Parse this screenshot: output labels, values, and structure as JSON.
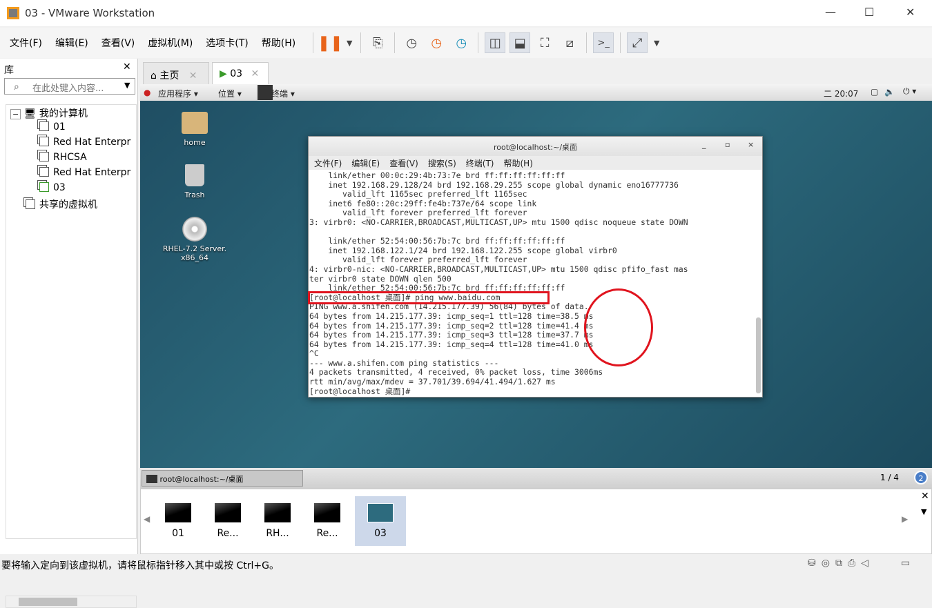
{
  "window": {
    "title": "03 - VMware Workstation",
    "min": "—",
    "max": "☐",
    "close": "✕"
  },
  "menu": [
    "文件(F)",
    "编辑(E)",
    "查看(V)",
    "虚拟机(M)",
    "选项卡(T)",
    "帮助(H)"
  ],
  "toolbar": {
    "icons": [
      "pause-icon",
      "dropdown-icon",
      "send-ctrl-alt-del-icon",
      "snapshot-take-icon",
      "snapshot-revert-icon",
      "snapshot-manager-icon",
      "library-view-icon",
      "thumbnail-bar-icon",
      "fullscreen-icon",
      "unity-icon",
      "console-icon",
      "stretch-icon"
    ],
    "accent": "#e8641b"
  },
  "library": {
    "title": "库",
    "close": "✕",
    "search_placeholder": "在此处键入内容...",
    "tree": {
      "root": "我的计算机",
      "items": [
        "01",
        "Red Hat Enterpr",
        "RHCSA",
        "Red Hat Enterpr",
        "03"
      ],
      "shared": "共享的虚拟机"
    }
  },
  "tabs": [
    {
      "label": "主页",
      "close": "✕"
    },
    {
      "label": "03",
      "close": "✕"
    }
  ],
  "guest": {
    "topbar": {
      "apps": "应用程序 ▾",
      "places": "位置 ▾",
      "terminal": "终端 ▾",
      "clock": "二 20:07"
    },
    "desktop_icons": [
      {
        "label": "home"
      },
      {
        "label": "Trash"
      },
      {
        "label": "RHEL-7.2 Server.\nx86_64"
      }
    ],
    "terminal": {
      "title": "root@localhost:~/桌面",
      "controls": [
        "_",
        "▫",
        "×"
      ],
      "menu": [
        "文件(F)",
        "编辑(E)",
        "查看(V)",
        "搜索(S)",
        "终端(T)",
        "帮助(H)"
      ],
      "lines": [
        "    link/ether 00:0c:29:4b:73:7e brd ff:ff:ff:ff:ff:ff",
        "    inet 192.168.29.128/24 brd 192.168.29.255 scope global dynamic eno16777736",
        "       valid_lft 1165sec preferred_lft 1165sec",
        "    inet6 fe80::20c:29ff:fe4b:737e/64 scope link",
        "       valid_lft forever preferred_lft forever",
        "3: virbr0: <NO-CARRIER,BROADCAST,MULTICAST,UP> mtu 1500 qdisc noqueue state DOWN",
        "",
        "    link/ether 52:54:00:56:7b:7c brd ff:ff:ff:ff:ff:ff",
        "    inet 192.168.122.1/24 brd 192.168.122.255 scope global virbr0",
        "       valid_lft forever preferred_lft forever",
        "4: virbr0-nic: <NO-CARRIER,BROADCAST,MULTICAST,UP> mtu 1500 qdisc pfifo_fast mas",
        "ter virbr0 state DOWN qlen 500",
        "    link/ether 52:54:00:56:7b:7c brd ff:ff:ff:ff:ff:ff",
        "[root@localhost 桌面]# ping www.baidu.com",
        "PING www.a.shifen.com (14.215.177.39) 56(84) bytes of data.",
        "64 bytes from 14.215.177.39: icmp_seq=1 ttl=128 time=38.5 ms",
        "64 bytes from 14.215.177.39: icmp_seq=2 ttl=128 time=41.4 ms",
        "64 bytes from 14.215.177.39: icmp_seq=3 ttl=128 time=37.7 ms",
        "64 bytes from 14.215.177.39: icmp_seq=4 ttl=128 time=41.0 ms",
        "^C",
        "--- www.a.shifen.com ping statistics ---",
        "4 packets transmitted, 4 received, 0% packet loss, time 3006ms",
        "rtt min/avg/max/mdev = 37.701/39.694/41.494/1.627 ms",
        "[root@localhost 桌面]# "
      ]
    },
    "taskbar": {
      "window": "root@localhost:~/桌面",
      "workspace": "1 / 4",
      "badge": "2"
    },
    "annotation_color": "#e0141e"
  },
  "thumbnails": [
    {
      "label": "01"
    },
    {
      "label": "Re..."
    },
    {
      "label": "RH..."
    },
    {
      "label": "Re..."
    },
    {
      "label": "03"
    }
  ],
  "status": {
    "text": "要将输入定向到该虚拟机，请将鼠标指针移入其中或按 Ctrl+G。"
  }
}
